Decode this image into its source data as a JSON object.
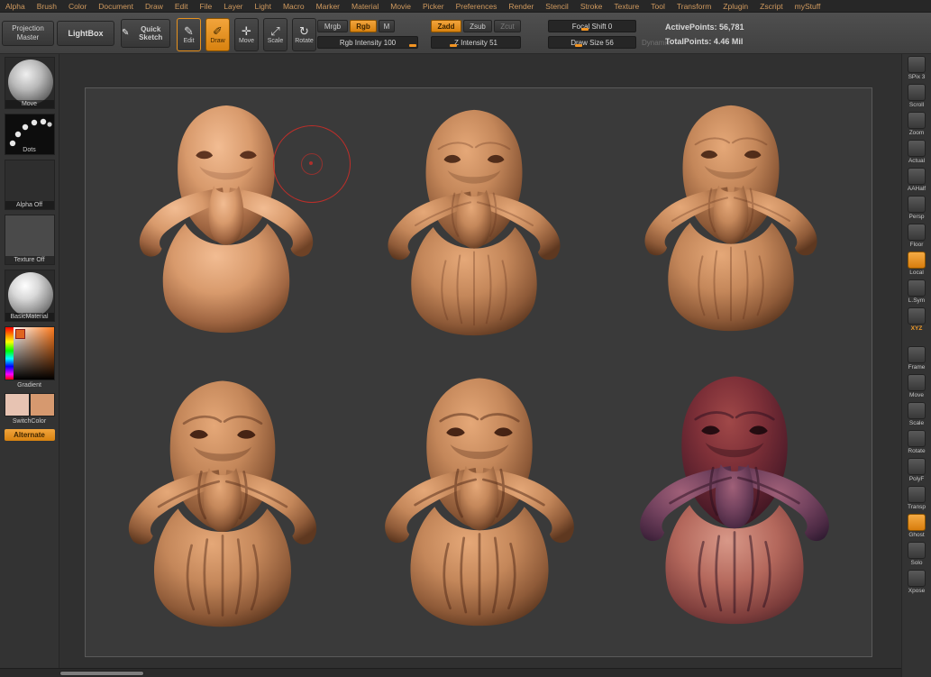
{
  "colors": {
    "accent": "#e8921e",
    "menu_text": "#d09a5f",
    "toolbar_bg": "#454545",
    "shelf_bg": "#333333",
    "canvas_bg": "#303030",
    "document_bg": "#3a3a3a",
    "clay": "#c4875a",
    "paint_head": "#7e3038",
    "paint_tentacle": "#74435f",
    "paint_chest": "#b4685c",
    "brush_cursor": "#cd2d28"
  },
  "icons": {
    "quick_sketch": "✎",
    "edit": "✎",
    "draw": "✐",
    "move": "✛",
    "scale": "⤢",
    "rotate": "↻"
  },
  "menu": {
    "items": [
      "Alpha",
      "Brush",
      "Color",
      "Document",
      "Draw",
      "Edit",
      "File",
      "Layer",
      "Light",
      "Macro",
      "Marker",
      "Material",
      "Movie",
      "Picker",
      "Preferences",
      "Render",
      "Stencil",
      "Stroke",
      "Texture",
      "Tool",
      "Transform",
      "Zplugin",
      "Zscript",
      "myStuff"
    ]
  },
  "toolbar": {
    "projection_master": "Projection Master",
    "lightbox": "LightBox",
    "quick_sketch": "Quick Sketch",
    "edit": "Edit",
    "draw": "Draw",
    "move": "Move",
    "scale": "Scale",
    "rotate": "Rotate",
    "mrgb": "Mrgb",
    "rgb": "Rgb",
    "m": "M",
    "rgb_intensity": "Rgb Intensity 100",
    "zadd": "Zadd",
    "zsub": "Zsub",
    "zcut": "Zcut",
    "z_intensity": "Z Intensity 51",
    "focal_shift": "Focal Shift 0",
    "draw_size": "Draw Size 56",
    "dynamic": "Dynamic",
    "active_points": "ActivePoints: 56,781",
    "total_points": "TotalPoints: 4.46 Mil"
  },
  "shelf_left": {
    "tool_label": "Move",
    "stroke_label": "Dots",
    "alpha_label": "Alpha Off",
    "texture_label": "Texture Off",
    "material_label": "BasicMaterial",
    "gradient_label": "Gradient",
    "switch_color_label": "SwitchColor",
    "alternate_label": "Alternate",
    "main_color": "#e7c3b2",
    "secondary_color": "#d6996f"
  },
  "shelf_right": {
    "items": [
      {
        "label": "SPix 3",
        "icon": "spix-icon"
      },
      {
        "label": "Scroll",
        "icon": "scroll-icon"
      },
      {
        "label": "Zoom",
        "icon": "zoom-icon"
      },
      {
        "label": "Actual",
        "icon": "actual-icon"
      },
      {
        "label": "AAHalf",
        "icon": "aahalf-icon"
      },
      {
        "label": "Persp",
        "icon": "persp-icon"
      },
      {
        "label": "Floor",
        "icon": "floor-icon"
      },
      {
        "label": "Local",
        "icon": "local-icon",
        "state": "active"
      },
      {
        "label": "L.Sym",
        "icon": "lsym-icon"
      },
      {
        "label": "XYZ",
        "icon": "xyz-icon",
        "state": "accent",
        "gap": "after"
      },
      {
        "label": "Frame",
        "icon": "frame-icon"
      },
      {
        "label": "Move",
        "icon": "move-icon"
      },
      {
        "label": "Scale",
        "icon": "scale-icon"
      },
      {
        "label": "Rotate",
        "icon": "rotate-icon"
      },
      {
        "label": "PolyF",
        "icon": "polyf-icon"
      },
      {
        "label": "Transp",
        "icon": "transp-icon"
      },
      {
        "label": "Ghost",
        "icon": "ghost-icon",
        "state": "active"
      },
      {
        "label": "Solo",
        "icon": "solo-icon"
      },
      {
        "label": "Xpose",
        "icon": "xpose-icon"
      }
    ]
  }
}
